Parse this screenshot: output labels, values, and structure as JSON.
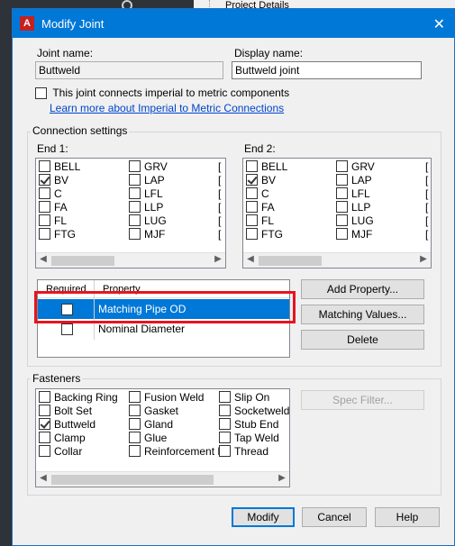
{
  "background": {
    "tree_item": "Project Details"
  },
  "dialog": {
    "title": "Modify Joint",
    "app_icon": "A",
    "close_glyph": "✕",
    "joint_name_label": "Joint name:",
    "joint_name_value": "Buttweld",
    "display_name_label": "Display name:",
    "display_name_value": "Buttweld joint",
    "imperial_checkbox_label": "This joint connects imperial to metric components",
    "learn_more_link": "Learn more about Imperial to Metric Connections",
    "connection_settings": {
      "title": "Connection settings",
      "end1_label": "End 1:",
      "end2_label": "End 2:",
      "end1": {
        "col1": [
          {
            "label": "BELL",
            "checked": false
          },
          {
            "label": "BV",
            "checked": true
          },
          {
            "label": "C",
            "checked": false
          },
          {
            "label": "FA",
            "checked": false
          },
          {
            "label": "FL",
            "checked": false
          },
          {
            "label": "FTG",
            "checked": false
          }
        ],
        "col2": [
          {
            "label": "GRV",
            "checked": false
          },
          {
            "label": "LAP",
            "checked": false
          },
          {
            "label": "LFL",
            "checked": false
          },
          {
            "label": "LLP",
            "checked": false
          },
          {
            "label": "LUG",
            "checked": false
          },
          {
            "label": "MJF",
            "checked": false
          }
        ]
      },
      "end2": {
        "col1": [
          {
            "label": "BELL",
            "checked": false
          },
          {
            "label": "BV",
            "checked": true
          },
          {
            "label": "C",
            "checked": false
          },
          {
            "label": "FA",
            "checked": false
          },
          {
            "label": "FL",
            "checked": false
          },
          {
            "label": "FTG",
            "checked": false
          }
        ],
        "col2": [
          {
            "label": "GRV",
            "checked": false
          },
          {
            "label": "LAP",
            "checked": false
          },
          {
            "label": "LFL",
            "checked": false
          },
          {
            "label": "LLP",
            "checked": false
          },
          {
            "label": "LUG",
            "checked": false
          },
          {
            "label": "MJF",
            "checked": false
          }
        ]
      },
      "grid": {
        "col_required": "Required",
        "col_property": "Property",
        "rows": [
          {
            "required": false,
            "property": "Matching Pipe OD",
            "selected": true
          },
          {
            "required": false,
            "property": "Nominal Diameter",
            "selected": false
          }
        ]
      },
      "add_property_button": "Add Property...",
      "matching_values_button": "Matching Values...",
      "delete_button": "Delete"
    },
    "fasteners": {
      "title": "Fasteners",
      "col1": [
        {
          "label": "Backing Ring",
          "checked": false
        },
        {
          "label": "Bolt Set",
          "checked": false
        },
        {
          "label": "Buttweld",
          "checked": true
        },
        {
          "label": "Clamp",
          "checked": false
        },
        {
          "label": "Collar",
          "checked": false
        }
      ],
      "col2": [
        {
          "label": "Fusion Weld",
          "checked": false
        },
        {
          "label": "Gasket",
          "checked": false
        },
        {
          "label": "Gland",
          "checked": false
        },
        {
          "label": "Glue",
          "checked": false
        },
        {
          "label": "Reinforcement R",
          "checked": false
        }
      ],
      "col3": [
        {
          "label": "Slip On",
          "checked": false
        },
        {
          "label": "Socketweld",
          "checked": false
        },
        {
          "label": "Stub End",
          "checked": false
        },
        {
          "label": "Tap Weld",
          "checked": false
        },
        {
          "label": "Thread",
          "checked": false
        }
      ],
      "spec_filter_button": "Spec Filter..."
    },
    "modify_button": "Modify",
    "cancel_button": "Cancel",
    "help_button": "Help"
  },
  "colors": {
    "titlebar": "#0078d7",
    "selection": "#0078d7",
    "highlight_box": "#e8141c",
    "link": "#0044cc"
  }
}
